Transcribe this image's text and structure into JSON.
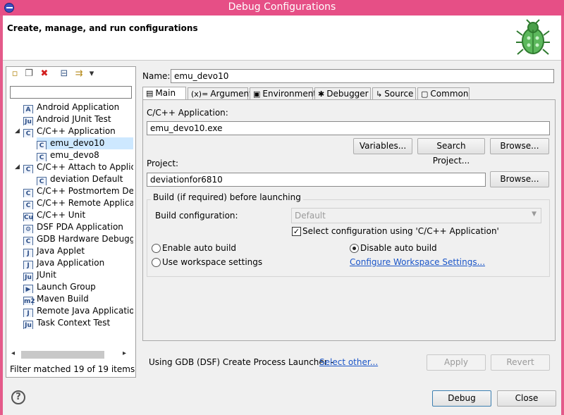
{
  "window": {
    "title": "Debug Configurations"
  },
  "header": {
    "text": "Create, manage, and run configurations"
  },
  "left": {
    "toolbar": [
      {
        "name": "new-configuration-icon",
        "glyph": "▫"
      },
      {
        "name": "duplicate-icon",
        "glyph": "❐"
      },
      {
        "name": "delete-icon",
        "glyph": "✖"
      },
      {
        "name": "collapse-all-icon",
        "glyph": "⊟"
      },
      {
        "name": "filter-icon",
        "glyph": "⇉"
      },
      {
        "name": "view-menu-icon",
        "glyph": "▾"
      }
    ],
    "filter_value": "",
    "tree": [
      {
        "label": "Android Application",
        "icon": "A",
        "indent": 0,
        "arrow": ""
      },
      {
        "label": "Android JUnit Test",
        "icon": "Ju",
        "indent": 0,
        "arrow": ""
      },
      {
        "label": "C/C++ Application",
        "icon": "C",
        "indent": 0,
        "arrow": "◢"
      },
      {
        "label": "emu_devo10",
        "icon": "C",
        "indent": 1,
        "arrow": "",
        "selected": true
      },
      {
        "label": "emu_devo8",
        "icon": "C",
        "indent": 1,
        "arrow": ""
      },
      {
        "label": "C/C++ Attach to Application",
        "icon": "C",
        "indent": 0,
        "arrow": "◢"
      },
      {
        "label": "deviation Default",
        "icon": "C",
        "indent": 1,
        "arrow": ""
      },
      {
        "label": "C/C++ Postmortem Debugger",
        "icon": "C",
        "indent": 0,
        "arrow": ""
      },
      {
        "label": "C/C++ Remote Application",
        "icon": "C",
        "indent": 0,
        "arrow": ""
      },
      {
        "label": "C/C++ Unit",
        "icon": "Cu",
        "indent": 0,
        "arrow": ""
      },
      {
        "label": "DSF PDA Application",
        "icon": "⚙",
        "indent": 0,
        "arrow": ""
      },
      {
        "label": "GDB Hardware Debugging",
        "icon": "C",
        "indent": 0,
        "arrow": ""
      },
      {
        "label": "Java Applet",
        "icon": "J",
        "indent": 0,
        "arrow": ""
      },
      {
        "label": "Java Application",
        "icon": "J",
        "indent": 0,
        "arrow": ""
      },
      {
        "label": "JUnit",
        "icon": "Ju",
        "indent": 0,
        "arrow": ""
      },
      {
        "label": "Launch Group",
        "icon": "▶",
        "indent": 0,
        "arrow": ""
      },
      {
        "label": "Maven Build",
        "icon": "m2",
        "indent": 0,
        "arrow": ""
      },
      {
        "label": "Remote Java Application",
        "icon": "J",
        "indent": 0,
        "arrow": ""
      },
      {
        "label": "Task Context Test",
        "icon": "Ju",
        "indent": 0,
        "arrow": ""
      }
    ],
    "filter_status": "Filter matched 19 of 19 items"
  },
  "main": {
    "name_label": "Name:",
    "name_value": "emu_devo10",
    "tabs": [
      {
        "label": "Main",
        "icon": "▤"
      },
      {
        "label": "Arguments",
        "icon": "(x)="
      },
      {
        "label": "Environment",
        "icon": "▣"
      },
      {
        "label": "Debugger",
        "icon": "✱"
      },
      {
        "label": "Source",
        "icon": "↳"
      },
      {
        "label": "Common",
        "icon": "▢"
      }
    ],
    "app_label": "C/C++ Application:",
    "app_value": "emu_devo10.exe",
    "variables_button": "Variables...",
    "search_project_button": "Search Project...",
    "browse_button_1": "Browse...",
    "project_label": "Project:",
    "project_value": "deviationfor6810",
    "browse_button_2": "Browse...",
    "build_group_title": "Build (if required) before launching",
    "build_config_label": "Build configuration:",
    "build_config_value": "Default",
    "select_config_label": "Select configuration using 'C/C++ Application'",
    "select_config_checked": true,
    "enable_auto_build": "Enable auto build",
    "disable_auto_build": "Disable auto build",
    "use_workspace_settings": "Use workspace settings",
    "configure_workspace_link": "Configure Workspace Settings...",
    "launcher_text": "Using GDB (DSF) Create Process Launcher - ",
    "select_other_link": "Select other...",
    "apply_button": "Apply",
    "revert_button": "Revert"
  },
  "footer": {
    "debug_button": "Debug",
    "close_button": "Close"
  }
}
